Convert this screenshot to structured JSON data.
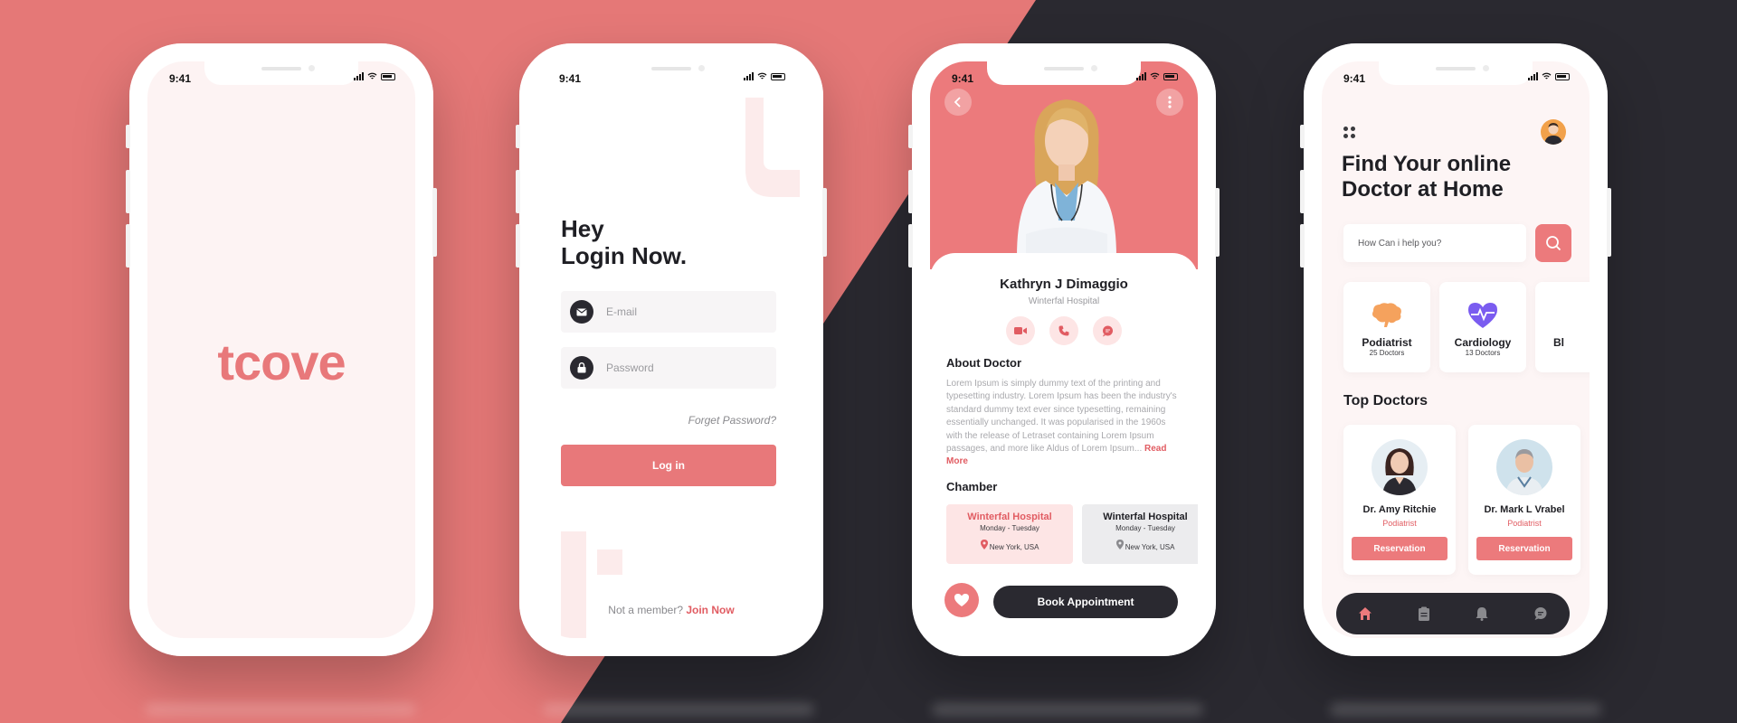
{
  "colors": {
    "brand_pink": "#e8787a",
    "bg_pink": "#e57877",
    "bg_dark": "#2a2930",
    "accent_red": "#e15c62",
    "dark": "#2a2930"
  },
  "status": {
    "time": "9:41"
  },
  "splash": {
    "logo": "tcove"
  },
  "login": {
    "title_line1": "Hey",
    "title_line2": "Login Now.",
    "email_placeholder": "E-mail",
    "password_placeholder": "Password",
    "forget": "Forget Password?",
    "login_button": "Log in",
    "not_member": "Not a member?",
    "join": "Join Now",
    "icons": [
      "mail-icon",
      "lock-icon"
    ]
  },
  "profile": {
    "doctor_name": "Kathryn J Dimaggio",
    "hospital": "Winterfal Hospital",
    "actions": [
      "video-icon",
      "phone-icon",
      "chat-icon"
    ],
    "about_title": "About Doctor",
    "about_text": "Lorem Ipsum is simply dummy text of the printing and typesetting industry. Lorem Ipsum has been the industry's standard dummy text ever since typesetting, remaining essentially unchanged. It was popularised in the 1960s with the release of Letraset containing Lorem Ipsum passages, and more like Aldus of Lorem Ipsum...",
    "read_more": "Read More",
    "chamber_title": "Chamber",
    "chambers": [
      {
        "name": "Winterfal Hospital",
        "days": "Monday - Tuesday",
        "location": "New York, USA"
      },
      {
        "name": "Winterfal Hospital",
        "days": "Monday - Tuesday",
        "location": "New York, USA"
      }
    ],
    "book_button": "Book Appointment"
  },
  "home": {
    "title_line1": "Find Your online",
    "title_line2": "Doctor at Home",
    "search_placeholder": "How Can i help you?",
    "categories": [
      {
        "name": "Podiatrist",
        "count": "25 Doctors",
        "icon": "brain-icon"
      },
      {
        "name": "Cardiology",
        "count": "13 Doctors",
        "icon": "heart-pulse-icon"
      },
      {
        "name": "Bl",
        "count": "",
        "icon": ""
      }
    ],
    "top_doctors_title": "Top Doctors",
    "doctors": [
      {
        "name": "Dr. Amy Ritchie",
        "specialty": "Podiatrist",
        "button": "Reservation"
      },
      {
        "name": "Dr. Mark L Vrabel",
        "specialty": "Podiatrist",
        "button": "Reservation"
      }
    ],
    "nav": [
      "home-icon",
      "clipboard-icon",
      "bell-icon",
      "chat-icon"
    ]
  }
}
